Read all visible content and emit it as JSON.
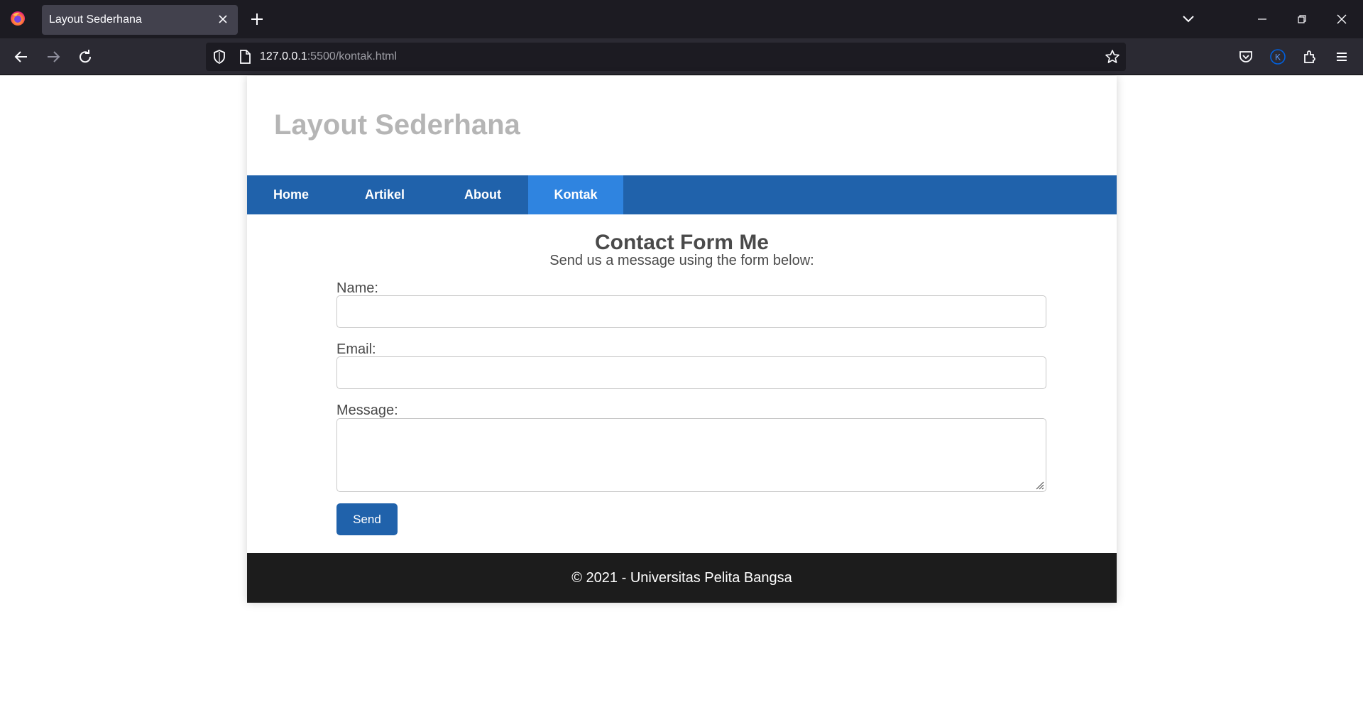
{
  "browser": {
    "tab_title": "Layout Sederhana",
    "url_host": "127.0.0.1",
    "url_rest": ":5500/kontak.html",
    "icons": [
      "firefox-logo",
      "close-icon",
      "plus-icon",
      "chevron-down-icon",
      "minimize-icon",
      "restore-icon",
      "close-window-icon",
      "back-arrow-icon",
      "forward-arrow-icon",
      "reload-icon",
      "shield-icon",
      "page-icon",
      "star-icon",
      "pocket-icon",
      "account-icon",
      "extensions-icon",
      "hamburger-menu-icon"
    ]
  },
  "site": {
    "title": "Layout Sederhana",
    "nav": [
      {
        "label": "Home",
        "active": false
      },
      {
        "label": "Artikel",
        "active": false
      },
      {
        "label": "About",
        "active": false
      },
      {
        "label": "Kontak",
        "active": true
      }
    ],
    "colors": {
      "nav": "#2062ab",
      "nav_active": "#2f84e0",
      "footer": "#1c1c1c"
    }
  },
  "form": {
    "title": "Contact Form Me",
    "subtitle": "Send us a message using the form below:",
    "name_label": "Name:",
    "name_value": "",
    "email_label": "Email:",
    "email_value": "",
    "message_label": "Message:",
    "message_value": "",
    "send_label": "Send"
  },
  "footer": {
    "text": "© 2021 - Universitas Pelita Bangsa"
  }
}
